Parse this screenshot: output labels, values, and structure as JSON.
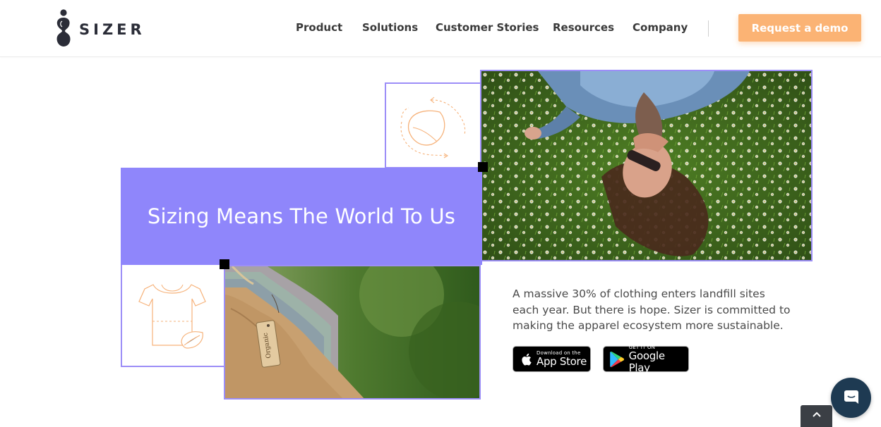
{
  "brand": {
    "name": "SIZER"
  },
  "nav": {
    "items": [
      {
        "label": "Product"
      },
      {
        "label": "Solutions"
      },
      {
        "label": "Customer Stories"
      },
      {
        "label": "Resources"
      },
      {
        "label": "Company"
      }
    ],
    "cta_label": "Request a demo"
  },
  "hero": {
    "headline": "Sizing Means The World To Us",
    "description": "A massive 30% of clothing enters landfill sites each year. But there is hope. Sizer is committed to making the apparel ecosystem more sustainable.",
    "tag_text": "Organic"
  },
  "app_store": {
    "small": "Download on the",
    "big": "App Store"
  },
  "google_play": {
    "small": "GET IT ON",
    "big": "Google Play"
  },
  "colors": {
    "accent_purple": "#8f86fb",
    "border_purple": "#9c8ef7",
    "cta_orange": "#fbb374",
    "icon_orange": "#f6b27a",
    "chat_navy": "#1e3a52"
  },
  "icons": [
    "brand-logo-icon",
    "leaf-cycle-icon",
    "tshirt-leaf-icon",
    "apple-icon",
    "google-play-icon",
    "chat-icon",
    "chevron-up-icon"
  ]
}
